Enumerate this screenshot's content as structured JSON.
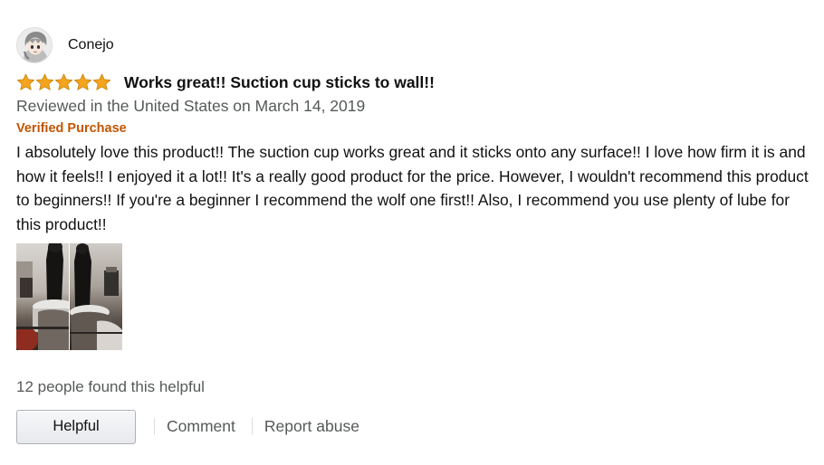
{
  "review": {
    "author": {
      "name": "Conejo",
      "avatar_icon": "anime-avatar-icon"
    },
    "rating": {
      "stars": 5,
      "max": 5,
      "star_color": "#f4a41d"
    },
    "title": "Works great!! Suction cup sticks to wall!!",
    "date_text": "Reviewed in the United States on March 14, 2019",
    "verified_label": "Verified Purchase",
    "body": "I absolutely love this product!! The suction cup works great and it sticks onto any surface!! I love how firm it is and how it feels!! I enjoyed it a lot!! It's a really good product for the price. However, I wouldn't recommend this product to beginners!! If you're a beginner I recommend the wolf one first!! Also, I recommend you use plenty of lube for this product!!",
    "images_count": 2,
    "helpful_count_text": "12 people found this helpful",
    "actions": {
      "helpful_label": "Helpful",
      "comment_label": "Comment",
      "report_label": "Report abuse"
    }
  },
  "colors": {
    "verified": "#c45500",
    "muted_text": "#565959",
    "body_text": "#111111"
  }
}
